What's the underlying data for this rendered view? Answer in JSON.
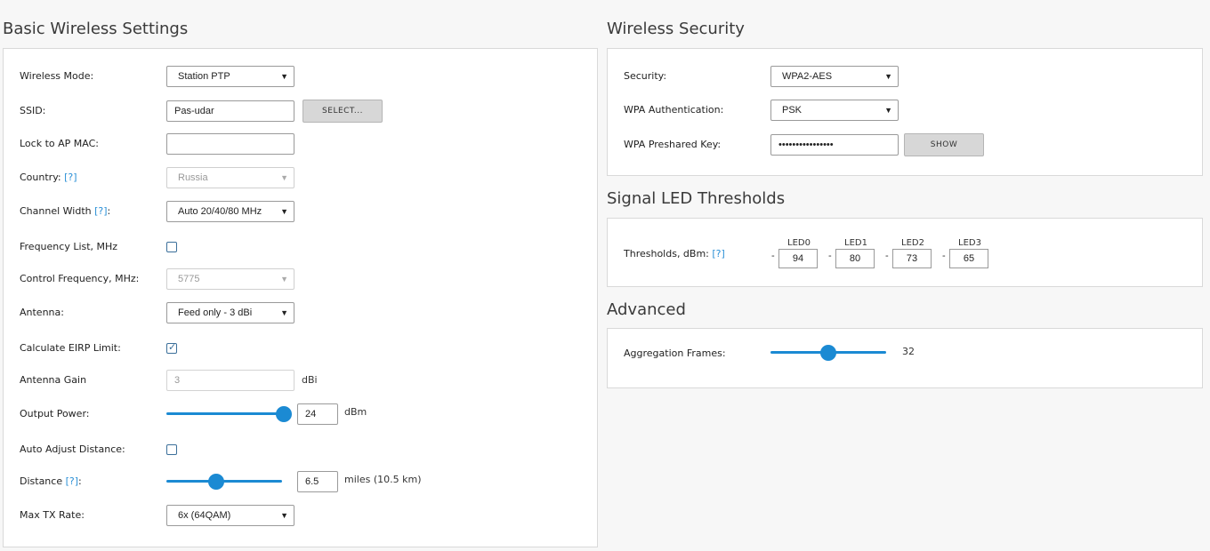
{
  "basic": {
    "title": "Basic Wireless Settings",
    "wireless_mode": {
      "label": "Wireless Mode:",
      "value": "Station PTP"
    },
    "ssid": {
      "label": "SSID:",
      "value": "Pas-udar",
      "button": "SELECT..."
    },
    "lock_ap_mac": {
      "label": "Lock to AP MAC:",
      "value": ""
    },
    "country": {
      "label": "Country:",
      "help": "[?]",
      "value": "Russia"
    },
    "channel_width": {
      "label": "Channel Width",
      "help": "[?]",
      "suffix": ":",
      "value": "Auto 20/40/80 MHz"
    },
    "frequency_list": {
      "label": "Frequency List, MHz",
      "checked": false
    },
    "control_frequency": {
      "label": "Control Frequency, MHz:",
      "value": "5775"
    },
    "antenna": {
      "label": "Antenna:",
      "value": "Feed only - 3 dBi"
    },
    "calc_eirp": {
      "label": "Calculate EIRP Limit:",
      "checked": true
    },
    "antenna_gain": {
      "label": "Antenna Gain",
      "value": "3",
      "unit": "dBi"
    },
    "output_power": {
      "label": "Output Power:",
      "value": "24",
      "unit": "dBm",
      "level": 1.0
    },
    "auto_adjust": {
      "label": "Auto Adjust Distance:",
      "checked": false
    },
    "distance": {
      "label": "Distance",
      "help": "[?]",
      "suffix": ":",
      "value": "6.5",
      "unit": "miles (10.5 km)",
      "level": 0.43
    },
    "max_tx_rate": {
      "label": "Max TX Rate:",
      "value": "6x (64QAM)"
    }
  },
  "security": {
    "title": "Wireless Security",
    "security": {
      "label": "Security:",
      "value": "WPA2-AES"
    },
    "wpa_auth": {
      "label": "WPA Authentication:",
      "value": "PSK"
    },
    "psk": {
      "label": "WPA Preshared Key:",
      "value": "••••••••••••••••",
      "button": "SHOW"
    }
  },
  "led": {
    "title": "Signal LED Thresholds",
    "label": "Thresholds, dBm:",
    "help": "[?]",
    "dash": "-",
    "items": [
      {
        "name": "LED0",
        "value": "94"
      },
      {
        "name": "LED1",
        "value": "80"
      },
      {
        "name": "LED2",
        "value": "73"
      },
      {
        "name": "LED3",
        "value": "65"
      }
    ]
  },
  "advanced": {
    "title": "Advanced",
    "aggregation": {
      "label": "Aggregation Frames:",
      "value": "32",
      "level": 0.5
    }
  },
  "colors": {
    "accent": "#1b8ad3",
    "help_link": "#2a8fd6"
  },
  "icons": {
    "dropdown": "caret-down-icon",
    "check": "checkmark-icon"
  }
}
